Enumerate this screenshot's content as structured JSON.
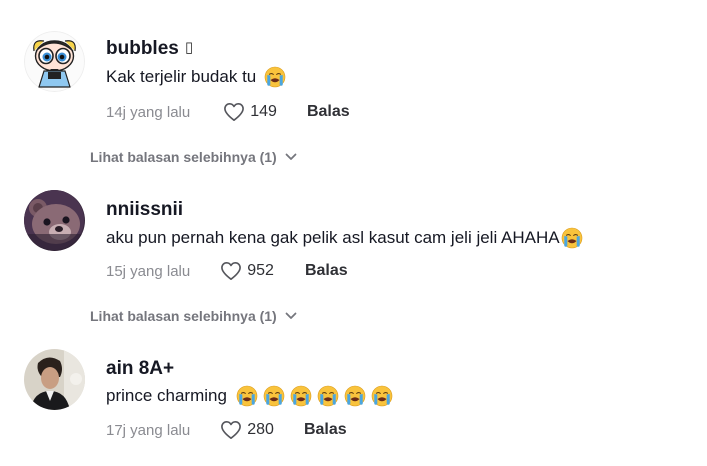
{
  "comments": [
    {
      "username": "bubbles",
      "badge": "▯",
      "avatar": "powerpuff-bubbles-avatar",
      "text": "Kak terjelir budak tu",
      "emoji_count": 1,
      "emoji": "crying-face",
      "time": "14j yang lalu",
      "likes": "149",
      "reply": "Balas",
      "view_more": "Lihat balasan selebihnya (1)"
    },
    {
      "username": "nniissnii",
      "avatar": "bear-avatar",
      "text": "aku pun pernah kena gak pelik asl kasut cam jeli jeli AHAHA",
      "emoji_count": 1,
      "emoji": "crying-face",
      "time": "15j yang lalu",
      "likes": "952",
      "reply": "Balas",
      "view_more": "Lihat balasan selebihnya (1)"
    },
    {
      "username": "ain 8A+",
      "avatar": "person-photo-avatar",
      "text": "prince charming",
      "emoji_count": 6,
      "emoji": "crying-face",
      "time": "17j yang lalu",
      "likes": "280",
      "reply": "Balas"
    }
  ],
  "colors": {
    "text": "#161823",
    "secondary": "#8a8b91",
    "emoji_face": "#f9c33c",
    "emoji_tears": "#4aa6e0"
  }
}
